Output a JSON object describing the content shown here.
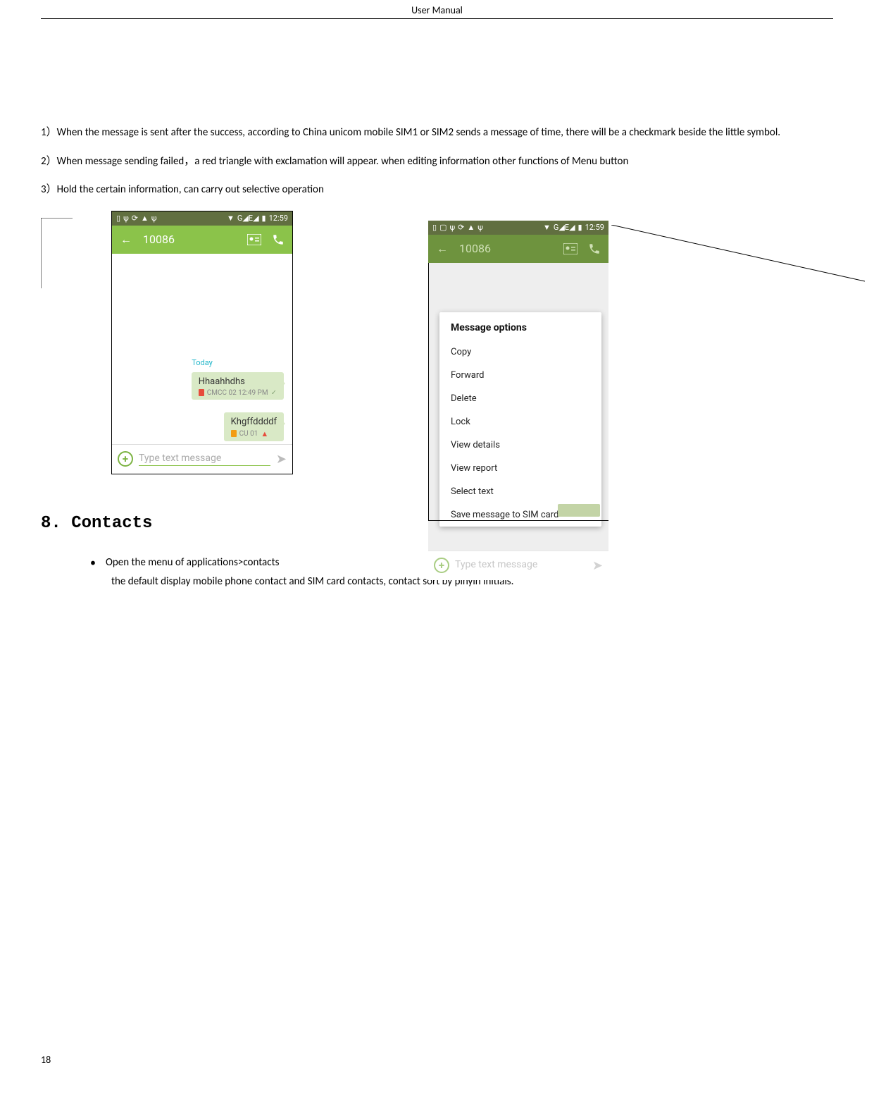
{
  "header": {
    "title": "User    Manual"
  },
  "paragraphs": {
    "p1": "1）When the message is sent after the success, according to China unicom mobile SIM1 or SIM2 sends a message of time, there will be a checkmark beside the little symbol.",
    "p2": "2）When message sending failed，a red triangle with exclamation will appear. when editing information other functions of Menu button",
    "p3": "3）Hold the certain information, can carry out selective operation"
  },
  "phone1": {
    "status_time": "12:59",
    "status_net": "G◢E◢",
    "title": "10086",
    "today": "Today",
    "msg1_text": "Hhaahhdhs",
    "msg1_meta": "CMCC 02 12:49 PM",
    "msg2_text": "Khgffddddf",
    "msg2_meta": "CU 01",
    "input_placeholder": "Type text message"
  },
  "phone2": {
    "status_time": "12:59",
    "status_net": "G◢E◢",
    "title": "10086",
    "options_title": "Message options",
    "options": [
      "Copy",
      "Forward",
      "Delete",
      "Lock",
      "View details",
      "View report",
      "Select text",
      "Save message to SIM card"
    ],
    "input_placeholder": "Type text message"
  },
  "section8": {
    "heading": "8. Contacts",
    "bullet1": "Open the menu of applications>contacts",
    "bullet1_sub": "the default display mobile phone contact and SIM card contacts, contact sort by pinyin initials."
  },
  "page_number": "18"
}
